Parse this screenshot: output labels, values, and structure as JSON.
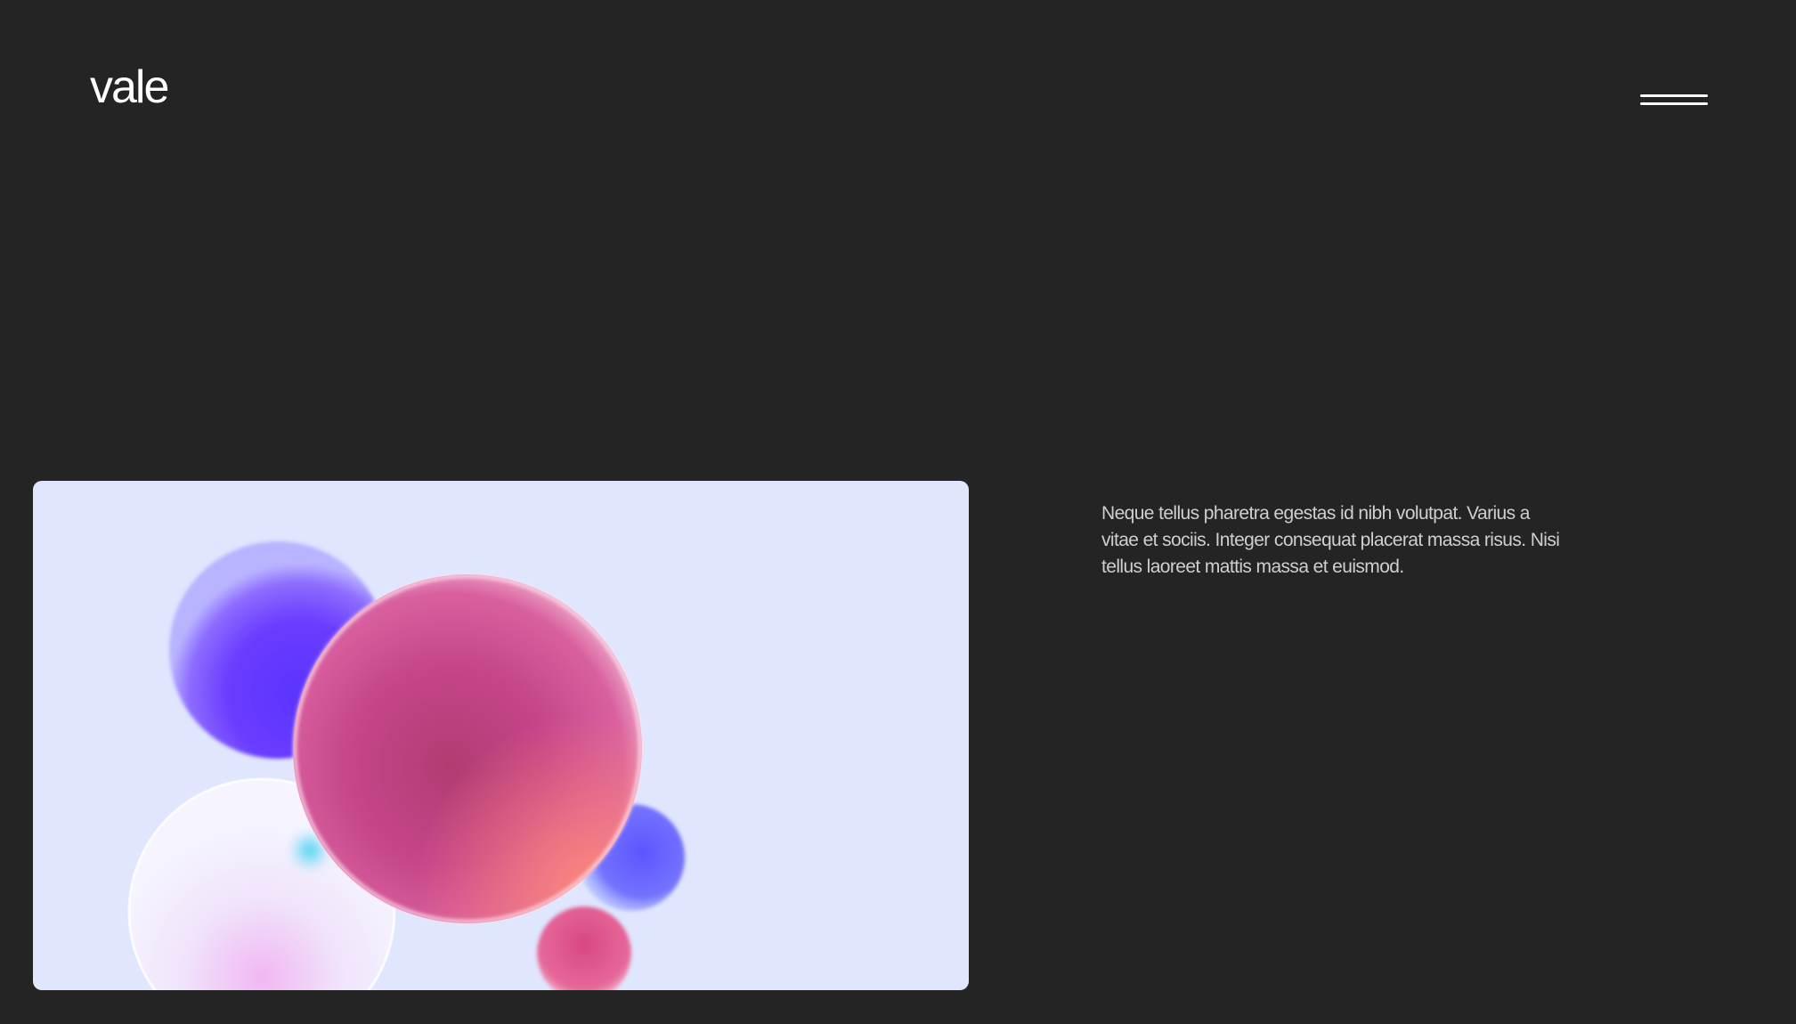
{
  "header": {
    "logo": "vale",
    "menu_icon": "hamburger-menu-icon"
  },
  "hero": {
    "image": "abstract-spheres-illustration",
    "description": "Neque tellus pharetra egestas id nibh volutpat. Varius a vitae et sociis. Integer consequat placerat massa risus. Nisi tellus laoreet mattis massa et euismod."
  },
  "colors": {
    "background": "#242424",
    "image_background": "#dfe6fd",
    "text": "#ffffff",
    "muted_text": "#cfcfcf",
    "sphere_violet": "#5b3bff",
    "sphere_magenta": "#c7448f",
    "sphere_blue": "#6b6bff",
    "sphere_pink": "#e05588",
    "sphere_cyan": "#55c9e8"
  }
}
